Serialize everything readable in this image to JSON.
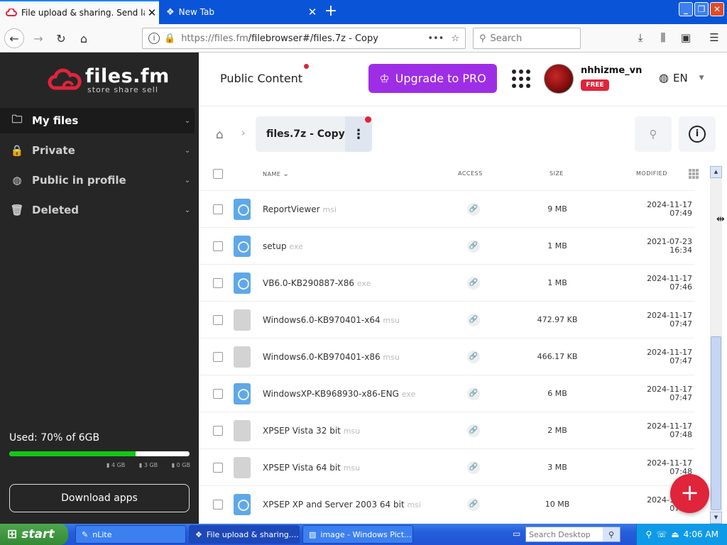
{
  "browser": {
    "tabs": [
      {
        "title": "File upload & sharing. Send large f",
        "active": true
      },
      {
        "title": "New Tab",
        "active": false
      }
    ],
    "url_host": "https://files.fm",
    "url_path": "/filebrowser#/files.7z - Copy",
    "search_placeholder": "Search"
  },
  "sidebar": {
    "brand": "files.fm",
    "tagline": "store share sell",
    "items": [
      {
        "label": "My files",
        "icon": "folder-open-icon",
        "active": true
      },
      {
        "label": "Private",
        "icon": "lock-icon",
        "active": false
      },
      {
        "label": "Public in profile",
        "icon": "globe-icon",
        "active": false
      },
      {
        "label": "Deleted",
        "icon": "trash-icon",
        "active": false
      }
    ],
    "usage_text": "Used: 70% of 6GB",
    "usage_fraction": 0.7,
    "usage_legend": [
      "4 GB",
      "3 GB",
      "0 GB"
    ],
    "download_apps": "Download apps"
  },
  "header": {
    "public_content": "Public Content",
    "upgrade": "Upgrade to PRO",
    "username": "nhhizme_vn",
    "plan_badge": "FREE",
    "language": "EN"
  },
  "breadcrumb": {
    "folder": "files.7z - Copy"
  },
  "table": {
    "columns": {
      "name": "NAME",
      "access": "ACCESS",
      "size": "SIZE",
      "modified": "MODIFIED"
    },
    "rows": [
      {
        "name": "ReportViewer",
        "ext": "msi",
        "icon": "app",
        "size": "9 MB",
        "date": "2024-11-17",
        "time": "07:49"
      },
      {
        "name": "setup",
        "ext": "exe",
        "icon": "app",
        "size": "1 MB",
        "date": "2021-07-23",
        "time": "16:34"
      },
      {
        "name": "VB6.0-KB290887-X86",
        "ext": "exe",
        "icon": "app",
        "size": "1 MB",
        "date": "2024-11-17",
        "time": "07:46"
      },
      {
        "name": "Windows6.0-KB970401-x64",
        "ext": "msu",
        "icon": "plain",
        "size": "472.97 KB",
        "date": "2024-11-17",
        "time": "07:47"
      },
      {
        "name": "Windows6.0-KB970401-x86",
        "ext": "msu",
        "icon": "plain",
        "size": "466.17 KB",
        "date": "2024-11-17",
        "time": "07:47"
      },
      {
        "name": "WindowsXP-KB968930-x86-ENG",
        "ext": "exe",
        "icon": "app",
        "size": "6 MB",
        "date": "2024-11-17",
        "time": "07:47"
      },
      {
        "name": "XPSEP Vista 32 bit",
        "ext": "msu",
        "icon": "plain",
        "size": "2 MB",
        "date": "2024-11-17",
        "time": "07:48"
      },
      {
        "name": "XPSEP Vista 64 bit",
        "ext": "msu",
        "icon": "plain",
        "size": "3 MB",
        "date": "2024-11-17",
        "time": "07:48"
      },
      {
        "name": "XPSEP XP and Server 2003 64 bit",
        "ext": "msi",
        "icon": "app",
        "size": "10 MB",
        "date": "2024-11-17",
        "time": "07:48"
      }
    ]
  },
  "taskbar": {
    "start": "start",
    "tasks": [
      {
        "label": "nLite",
        "active": false
      },
      {
        "label": "File upload & sharing....",
        "active": true
      },
      {
        "label": "image - Windows Pict...",
        "active": false
      }
    ],
    "desktop_search": "Search Desktop",
    "clock": "4:06 AM"
  },
  "colors": {
    "brand_red": "#e0243a",
    "upgrade_purple": "#9e2ee6",
    "usage_green": "#14c714",
    "sidebar_bg": "#262626"
  }
}
